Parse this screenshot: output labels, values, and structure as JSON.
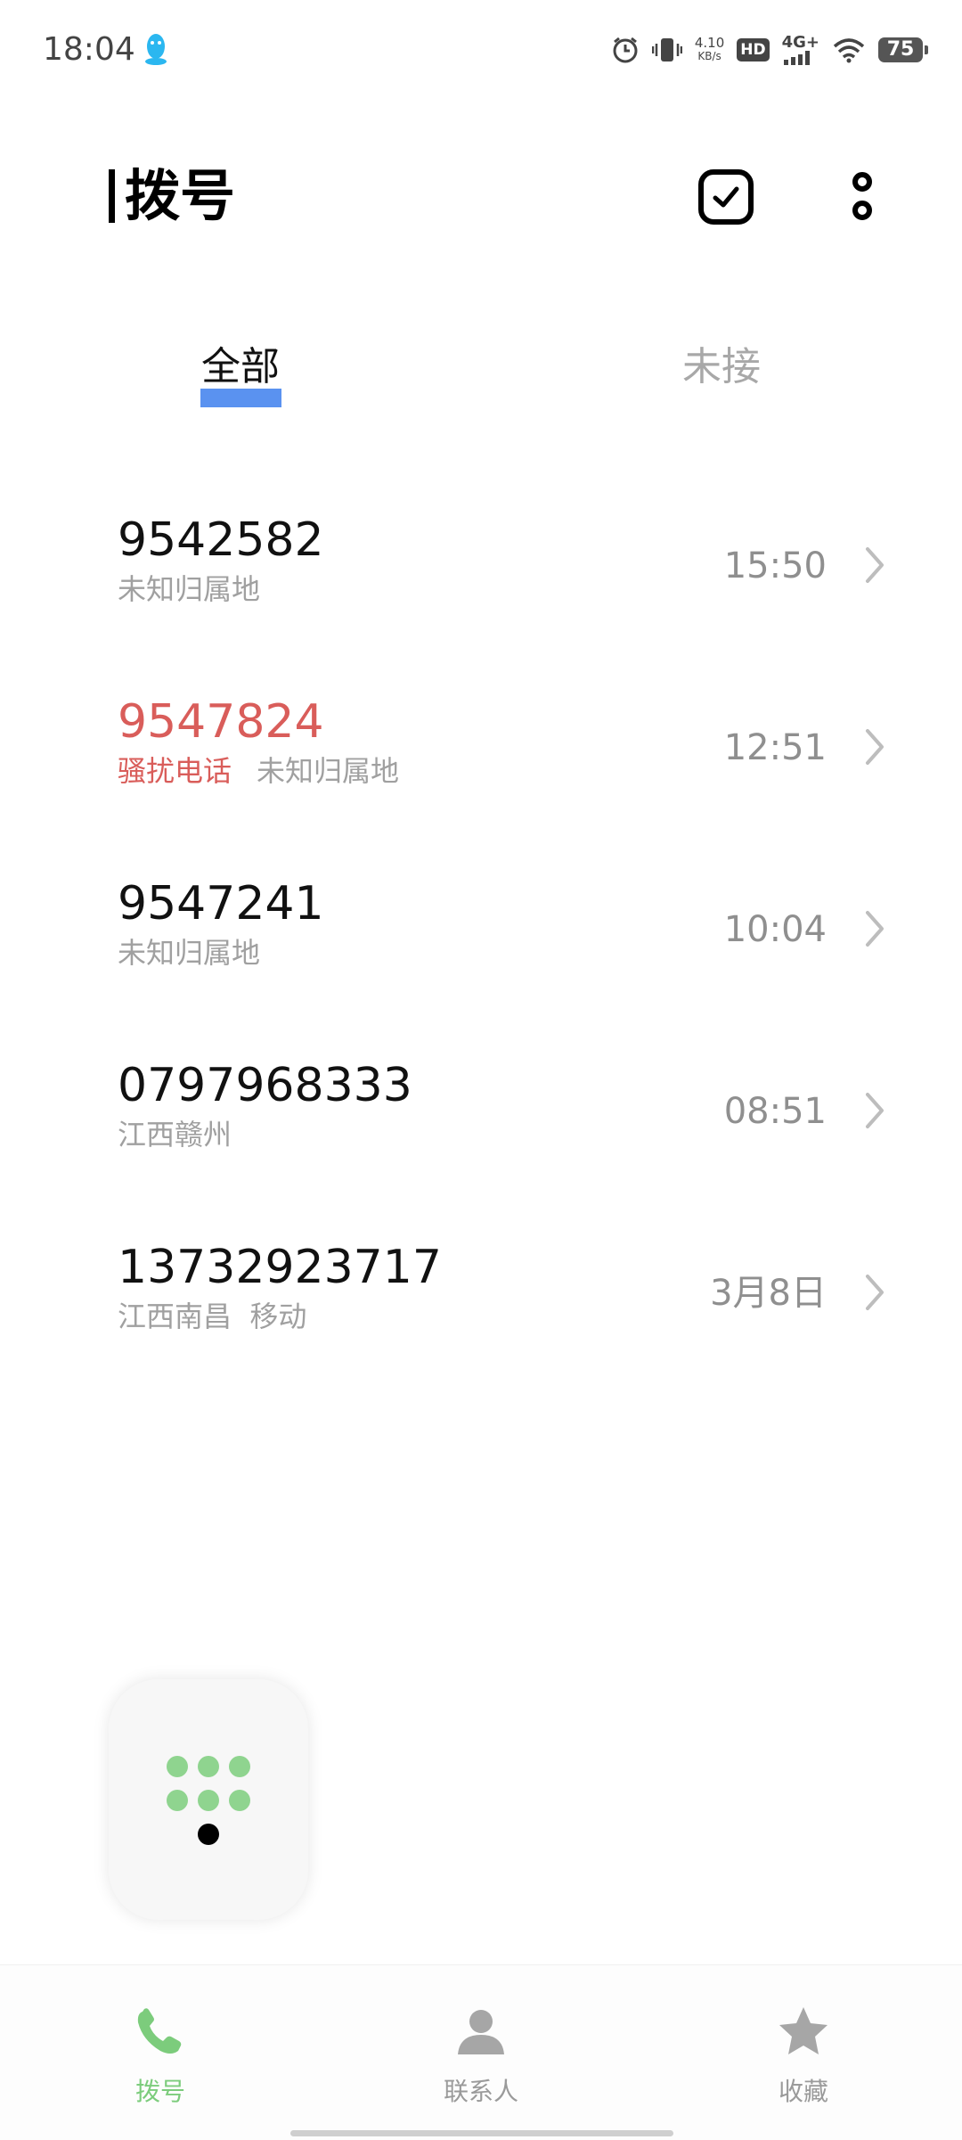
{
  "status_bar": {
    "time": "18:04",
    "net_speed_value": "4.10",
    "net_speed_unit": "KB/s",
    "hd_badge": "HD",
    "network_type": "4G+",
    "battery": "75",
    "icons": [
      "qq-penguin-icon",
      "alarm-icon",
      "vibrate-icon",
      "signal-icon",
      "wifi-icon",
      "battery-icon"
    ]
  },
  "header": {
    "title": "拨号",
    "actions": [
      "select-checkbox-icon",
      "more-icon"
    ]
  },
  "tabs": [
    {
      "label": "全部",
      "active": true
    },
    {
      "label": "未接",
      "active": false
    }
  ],
  "calls": [
    {
      "number": "9542582",
      "tag": "",
      "location": "未知归属地",
      "time": "15:50",
      "spam": false
    },
    {
      "number": "9547824",
      "tag": "骚扰电话",
      "location": "未知归属地",
      "time": "12:51",
      "spam": true
    },
    {
      "number": "9547241",
      "tag": "",
      "location": "未知归属地",
      "time": "10:04",
      "spam": false
    },
    {
      "number": "0797968333",
      "tag": "",
      "location": "江西赣州",
      "time": "08:51",
      "spam": false
    },
    {
      "number": "13732923717",
      "tag": "",
      "location": "江西南昌  移动",
      "time": "3月8日",
      "spam": false
    }
  ],
  "bottom_nav": [
    {
      "label": "拨号",
      "icon": "phone-icon",
      "active": true
    },
    {
      "label": "联系人",
      "icon": "contact-icon",
      "active": false
    },
    {
      "label": "收藏",
      "icon": "star-icon",
      "active": false
    }
  ],
  "colors": {
    "accent_blue": "#5a92f0",
    "spam_red": "#d95d5a",
    "active_green": "#7ccc7c",
    "dial_green": "#8fd48f"
  }
}
